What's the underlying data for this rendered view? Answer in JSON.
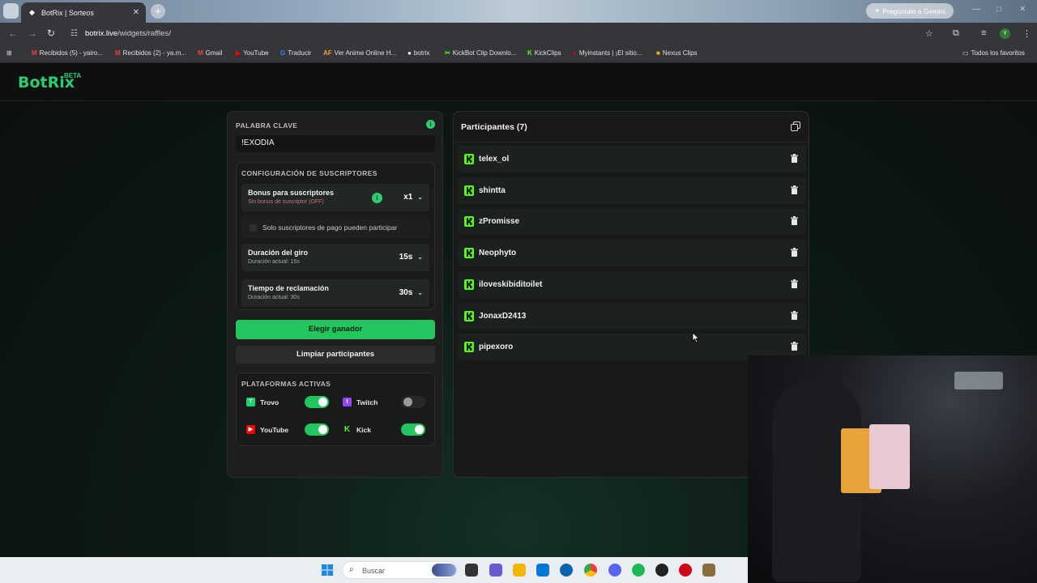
{
  "browser": {
    "tab_title": "BotRix | Sorteos",
    "tab_close": "✕",
    "new_tab": "+",
    "gemini_label": "Pregúntale a Gemini",
    "url_domain": "botrix.live",
    "url_path": "/widgets/raffles/",
    "profile_initial": "Y",
    "all_bookmarks": "Todos los favoritos",
    "bookmarks": [
      {
        "label": "Recibidos (5) - yairo...",
        "icon": "M",
        "color": "#ea4335"
      },
      {
        "label": "Recibidos (2) - ya.m...",
        "icon": "M",
        "color": "#ea4335"
      },
      {
        "label": "Gmail",
        "icon": "M",
        "color": "#ea4335"
      },
      {
        "label": "YouTube",
        "icon": "▶",
        "color": "#ff0000"
      },
      {
        "label": "Traducir",
        "icon": "G",
        "color": "#4285f4"
      },
      {
        "label": "Ver Anime Online H...",
        "icon": "AF",
        "color": "#f5a623"
      },
      {
        "label": "botrix",
        "icon": "●",
        "color": "#ffffff"
      },
      {
        "label": "KickBot Clip Downlo...",
        "icon": "✂",
        "color": "#53fc18"
      },
      {
        "label": "KickClips",
        "icon": "K",
        "color": "#53fc18"
      },
      {
        "label": "Myinstants | ¡El sitio...",
        "icon": "●",
        "color": "#d0021b"
      },
      {
        "label": "Nexus Clips",
        "icon": "■",
        "color": "#f5a623"
      }
    ]
  },
  "app": {
    "logo": "BotRix",
    "logo_badge": "BETA"
  },
  "raffle": {
    "keyword_label": "PALABRA CLAVE",
    "keyword_value": "!EXODIA",
    "subs_section": "CONFIGURACIÓN DE SUSCRIPTORES",
    "bonus_title": "Bonus para suscriptores",
    "bonus_sub": "Sin bonus de suscriptor (OFF)",
    "bonus_value": "x1",
    "paid_only_label": "Solo suscriptores de pago pueden participar",
    "spin_title": "Duración del giro",
    "spin_sub": "Duración actual: 15s",
    "spin_value": "15s",
    "claim_title": "Tiempo de reclamación",
    "claim_sub": "Duración actual: 30s",
    "claim_value": "30s",
    "pick_winner": "Elegir ganador",
    "clear_participants": "Limpiar participantes",
    "platforms_section": "PLATAFORMAS ACTIVAS",
    "platforms": [
      {
        "name": "Trovo",
        "enabled": true,
        "color": "#19d66b"
      },
      {
        "name": "Twitch",
        "enabled": false,
        "color": "#9146ff"
      },
      {
        "name": "YouTube",
        "enabled": true,
        "color": "#ff0000"
      },
      {
        "name": "Kick",
        "enabled": true,
        "color": "#53fc18"
      }
    ]
  },
  "participants": {
    "title": "Participantes (7)",
    "list": [
      "telex_ol",
      "shintta",
      "zPromisse",
      "Neophyto",
      "iloveskibiditoilet",
      "JonaxD2413",
      "pipexoro"
    ]
  },
  "taskbar": {
    "search_placeholder": "Buscar"
  },
  "colors": {
    "accent": "#22c55e",
    "kick": "#53fc18"
  }
}
